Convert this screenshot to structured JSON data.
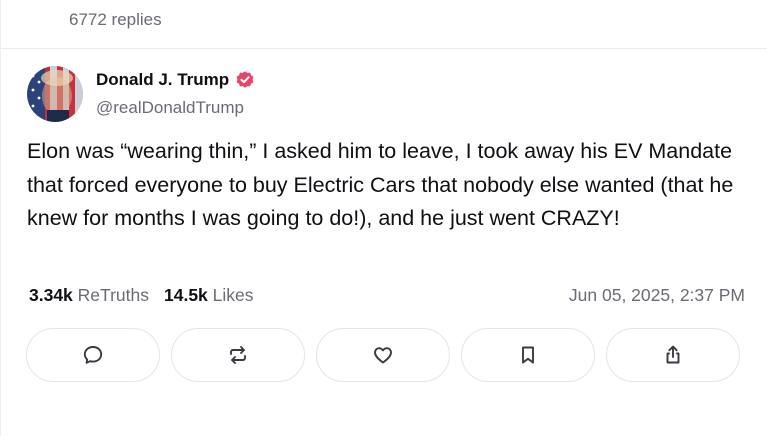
{
  "previous_post": {
    "replies_label": "6772 replies"
  },
  "post": {
    "author_name": "Donald J. Trump",
    "author_handle": "@realDonaldTrump",
    "verified": true,
    "verified_color": "#e8456b",
    "text": "Elon was “wearing thin,” I asked him to leave, I took away his EV Mandate that forced everyone to buy Electric Cars that nobody else wanted (that he knew for months I was going to do!), and he just went CRAZY!",
    "retruths_count": "3.34k",
    "retruths_label": "ReTruths",
    "likes_count": "14.5k",
    "likes_label": "Likes",
    "timestamp": "Jun 05, 2025, 2:37 PM"
  },
  "actions": [
    {
      "name": "reply",
      "icon": "comment-icon"
    },
    {
      "name": "retruth",
      "icon": "repost-icon"
    },
    {
      "name": "like",
      "icon": "heart-icon"
    },
    {
      "name": "bookmark",
      "icon": "bookmark-icon"
    },
    {
      "name": "share",
      "icon": "share-icon"
    }
  ],
  "colors": {
    "text_primary": "#0f0f14",
    "text_secondary": "#6b6b76",
    "border": "#e4e4ea"
  }
}
